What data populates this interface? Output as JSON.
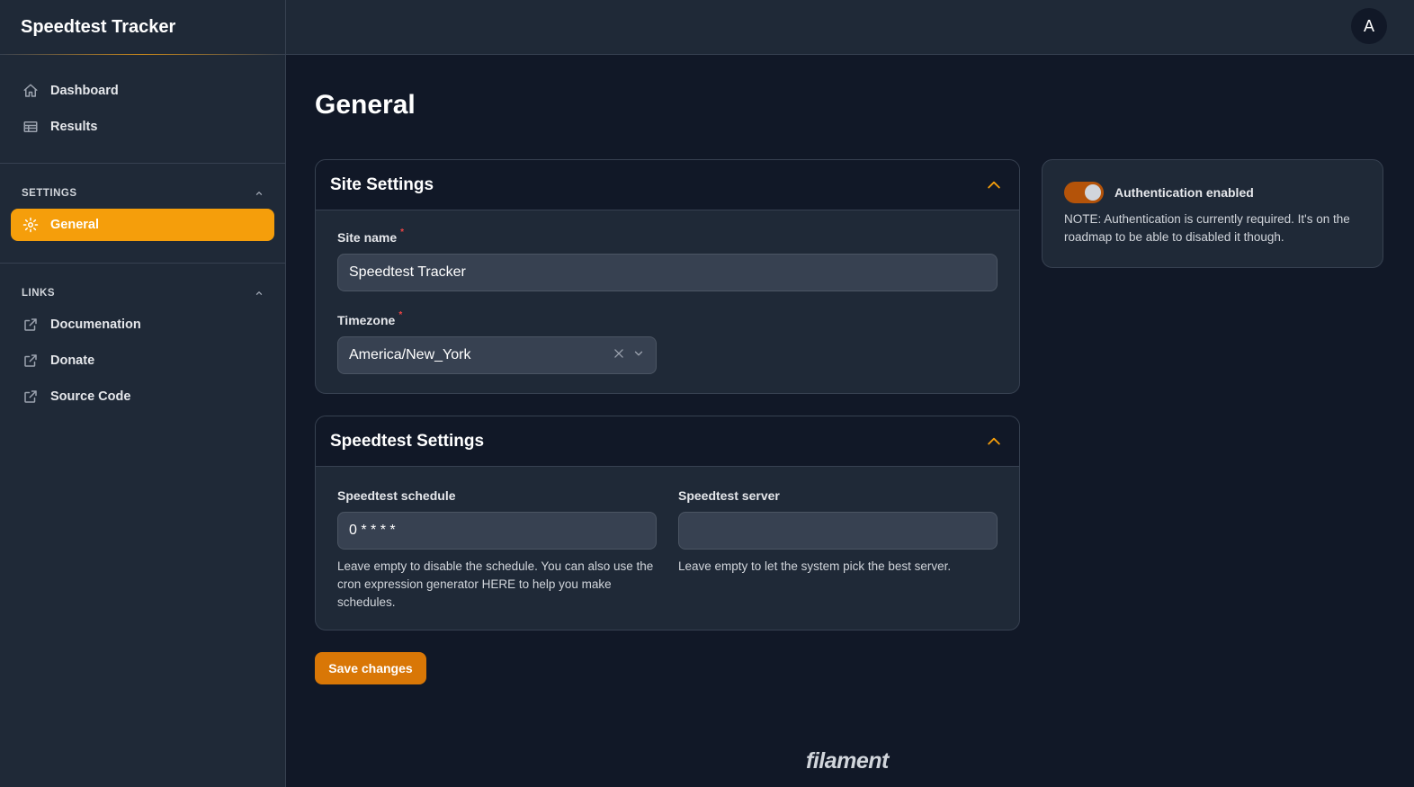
{
  "app": {
    "title": "Speedtest Tracker"
  },
  "user": {
    "avatar_initial": "A"
  },
  "sidebar": {
    "main_items": [
      {
        "label": "Dashboard",
        "icon": "home-icon"
      },
      {
        "label": "Results",
        "icon": "table-icon"
      }
    ],
    "groups": [
      {
        "label": "SETTINGS",
        "items": [
          {
            "label": "General",
            "icon": "gear-icon",
            "active": true
          }
        ]
      },
      {
        "label": "LINKS",
        "items": [
          {
            "label": "Documenation",
            "icon": "external-link-icon"
          },
          {
            "label": "Donate",
            "icon": "external-link-icon"
          },
          {
            "label": "Source Code",
            "icon": "external-link-icon"
          }
        ]
      }
    ]
  },
  "page": {
    "title": "General"
  },
  "site_settings": {
    "title": "Site Settings",
    "site_name": {
      "label": "Site name",
      "required_mark": "*",
      "value": "Speedtest Tracker"
    },
    "timezone": {
      "label": "Timezone",
      "required_mark": "*",
      "value": "America/New_York"
    }
  },
  "speedtest_settings": {
    "title": "Speedtest Settings",
    "schedule": {
      "label": "Speedtest schedule",
      "value": "0 * * * *",
      "help": "Leave empty to disable the schedule. You can also use the cron expression generator HERE to help you make schedules."
    },
    "server": {
      "label": "Speedtest server",
      "value": "",
      "help": "Leave empty to let the system pick the best server."
    }
  },
  "auth": {
    "label": "Authentication enabled",
    "enabled": true,
    "note": "NOTE: Authentication is currently required. It's on the roadmap to be able to disabled it though."
  },
  "actions": {
    "save_label": "Save changes"
  },
  "footer": {
    "brand": "filament"
  },
  "colors": {
    "accent": "#f59e0b",
    "background": "#111827",
    "panel": "#1f2937"
  }
}
